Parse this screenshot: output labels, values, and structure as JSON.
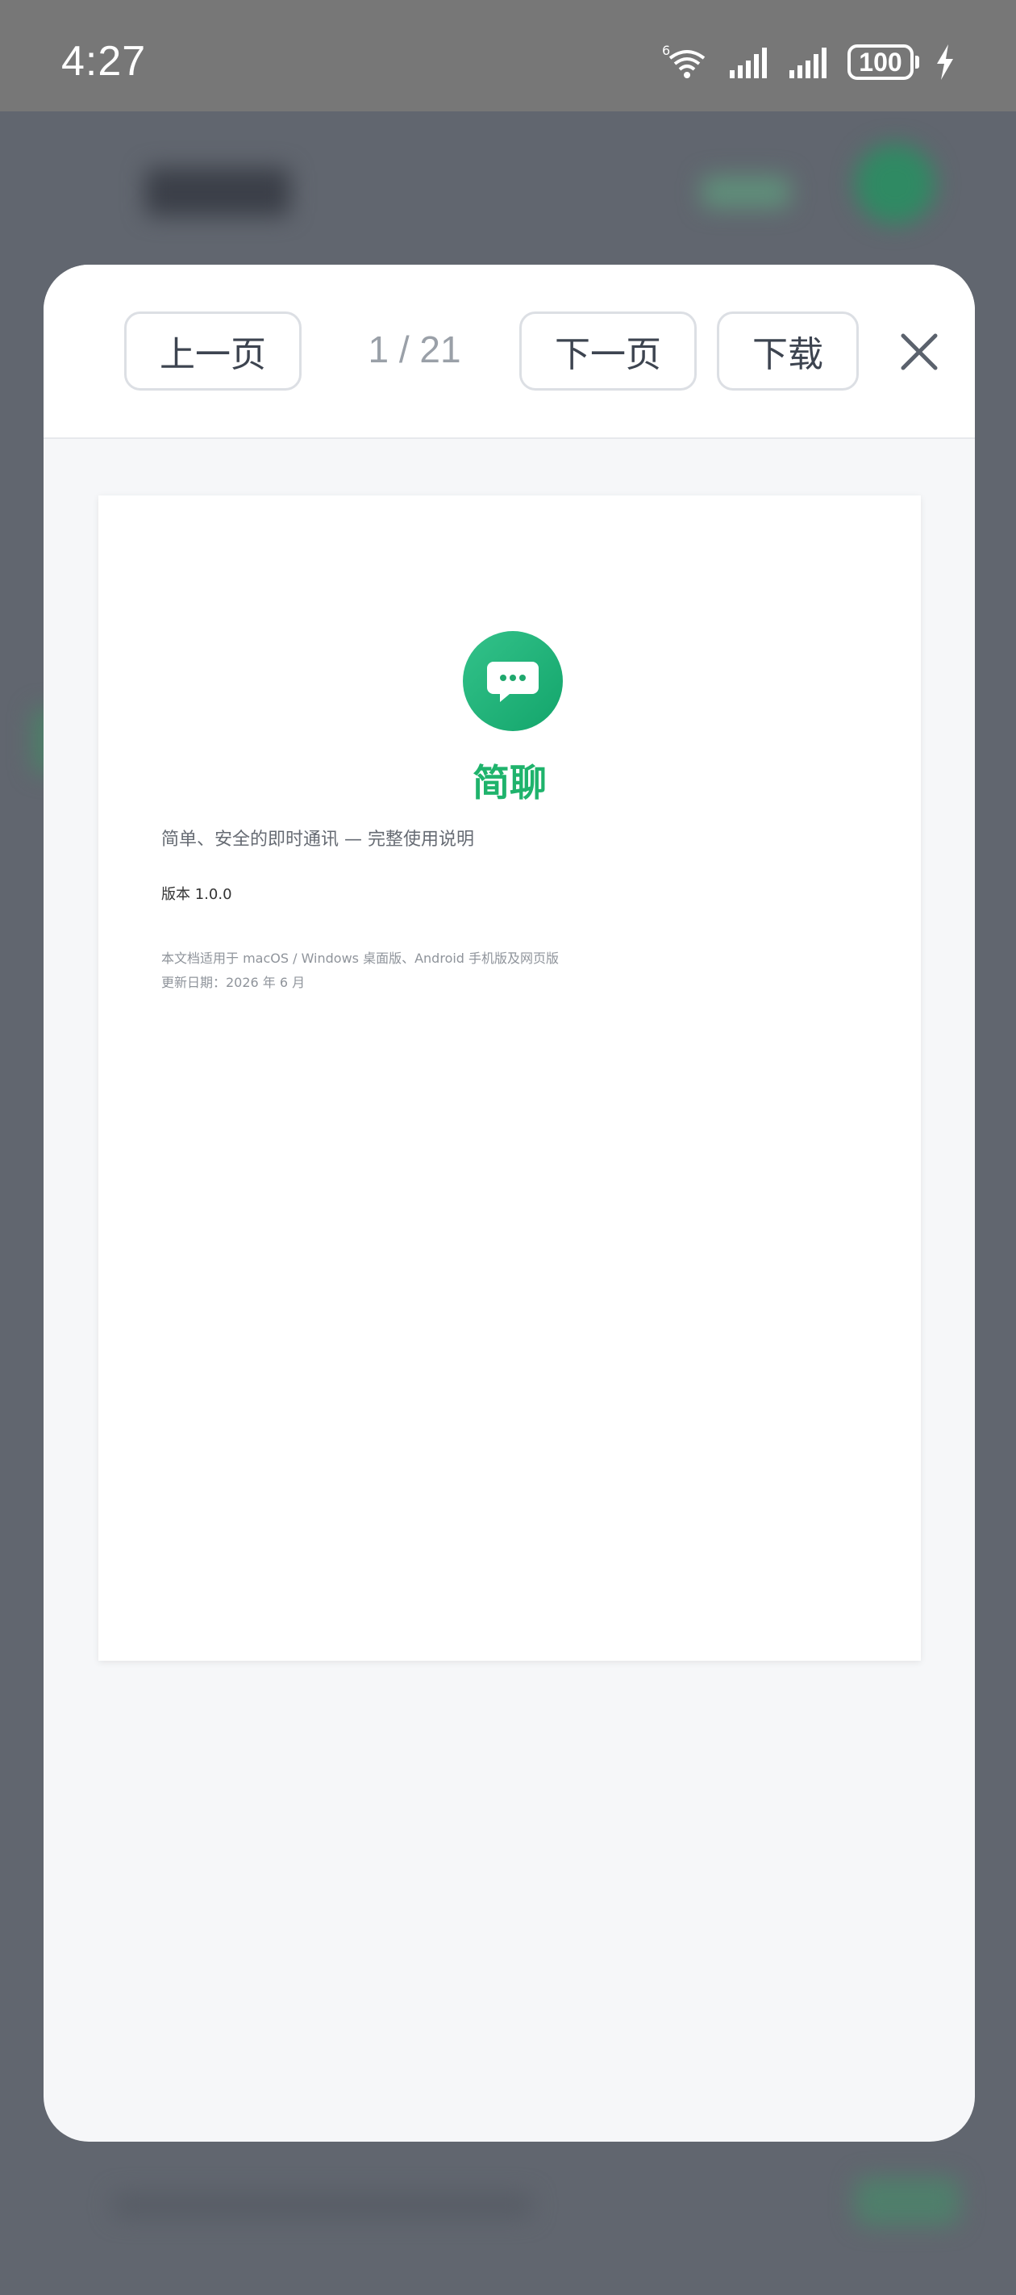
{
  "status_bar": {
    "time": "4:27",
    "battery": "100"
  },
  "viewer": {
    "prev_label": "上一页",
    "page_indicator": "1 / 21",
    "next_label": "下一页",
    "download_label": "下载"
  },
  "document": {
    "app_name": "简聊",
    "subtitle": "简单、安全的即时通讯 — 完整使用说明",
    "version": "版本 1.0.0",
    "applies_to": "本文档适用于 macOS / Windows 桌面版、Android 手机版及网页版",
    "updated": "更新日期：2026 年 6 月"
  },
  "colors": {
    "accent": "#1fb36c",
    "overlay": "#6a6f78"
  }
}
